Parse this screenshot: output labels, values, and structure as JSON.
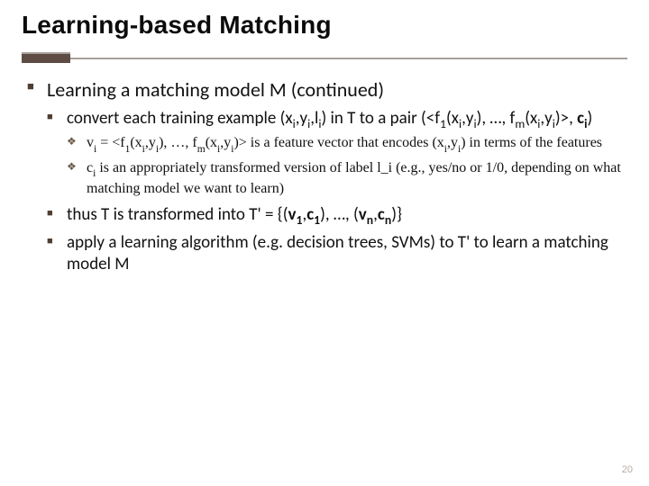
{
  "title": "Learning-based Matching",
  "lvl1": {
    "item": "Learning a matching model M (continued)"
  },
  "lvl2": {
    "a_pre": "convert each training example (x",
    "a_xi": "i",
    "a_mid1": ",y",
    "a_yi": "i",
    "a_mid2": ",l",
    "a_li": "i",
    "a_mid3": ") in T to a pair (<f",
    "a_f1": "1",
    "a_mid4": "(x",
    "a_xi2": "i",
    "a_mid5": ",y",
    "a_yi2": "i",
    "a_mid6": "), …, f",
    "a_fm": "m",
    "a_mid7": "(x",
    "a_xi3": "i",
    "a_mid8": ",y",
    "a_yi3": "i",
    "a_mid9": ")>, ",
    "a_c_pre": "c",
    "a_ci": "i",
    "a_end": ")",
    "b_pre": "thus T is transformed into T' = {(",
    "b_v1": "v",
    "b_v1s": "1",
    "b_mid1": ",",
    "b_c1": "c",
    "b_c1s": "1",
    "b_mid2": "), …, (",
    "b_vn": "v",
    "b_vns": "n",
    "b_mid3": ",",
    "b_cn": "c",
    "b_cns": "n",
    "b_end": ")}",
    "c": "apply a learning algorithm (e.g. decision trees, SVMs) to T' to learn a matching model M"
  },
  "lvl3": {
    "a_v": "v",
    "a_vi": "i",
    "a_eq": " = <f",
    "a_f1": "1",
    "a_mid1": "(x",
    "a_xi": "i",
    "a_mid2": ",y",
    "a_yi": "i",
    "a_mid3": "), …, f",
    "a_fm": "m",
    "a_mid4": "(x",
    "a_xi2": "i",
    "a_mid5": ",y",
    "a_yi2": "i",
    "a_mid6": ")> is a feature vector that encodes (x",
    "a_xi3": "i",
    "a_mid7": ",y",
    "a_yi3": "i",
    "a_end": ") in terms of the features",
    "b_c": "c",
    "b_ci": "i",
    "b_rest": " is an appropriately transformed version of label l_i (e.g., yes/no or 1/0, depending on what matching model we want to learn)"
  },
  "page_number": "20"
}
